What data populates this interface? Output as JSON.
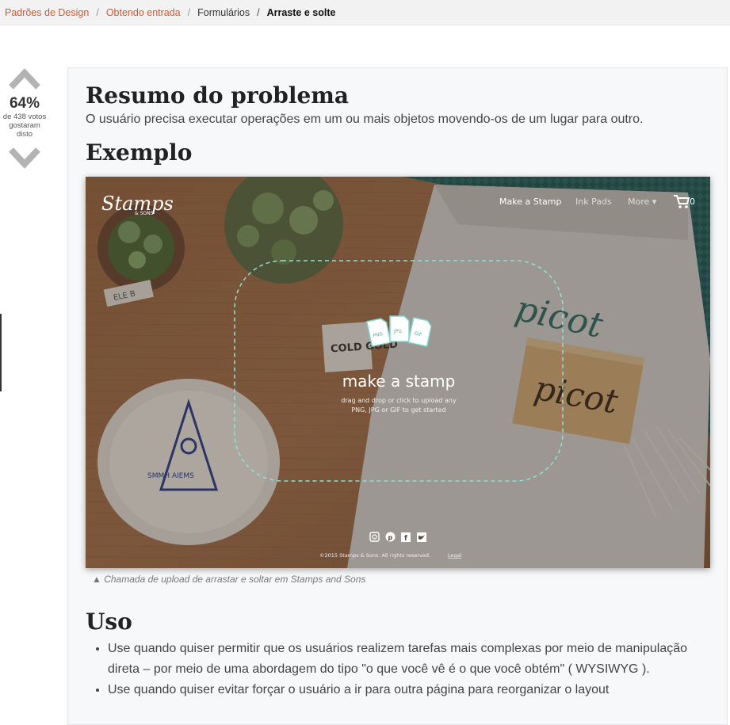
{
  "breadcrumb": {
    "items": [
      {
        "label": "Padrões de Design"
      },
      {
        "label": "Obtendo entrada"
      },
      {
        "label": "Formulários"
      },
      {
        "label": "Arraste e solte"
      }
    ],
    "separator": "/"
  },
  "vote": {
    "percent": "64%",
    "votes_line": "de 438 votos",
    "liked_line1": "gostaram",
    "liked_line2": "disto"
  },
  "content": {
    "summary_title": "Resumo do problema",
    "summary_text": "O usuário precisa executar operações em um ou mais objetos movendo-os de um lugar para outro.",
    "example_title": "Exemplo",
    "caption": "▲ Chamada de upload de arrastar e soltar em Stamps and Sons",
    "usage_title": "Uso",
    "usage_items": [
      "Use quando quiser permitir que os usuários realizem tarefas mais complexas por meio de manipulação direta – por meio de uma abordagem do tipo \"o que você vê é o que você obtém\" ( WYSIWYG ).",
      "Use quando quiser evitar forçar o usuário a ir para outra página para reorganizar o layout"
    ]
  },
  "example_screenshot": {
    "logo": "Stamps",
    "logo_sub": "& SONS",
    "nav": [
      "Make a Stamp",
      "Ink Pads",
      "More ▾"
    ],
    "cart_count": "0",
    "file_types": [
      "PNG",
      "JPG",
      "GIF"
    ],
    "heading": "make a stamp",
    "subtext_line1": "drag and drop or click to upload any",
    "subtext_line2": "PNG, JPG or GIF to get started",
    "footer": "©2015 Stamps & Sons. All rights reserved.",
    "footer_link": "Legal",
    "tag_text": "COLD GOLD",
    "card_word": "picot",
    "block_word": "picot",
    "small_tag": "ELE B",
    "bowl_text": "SMMH AIEMS",
    "colors": {
      "wood": "#b87a4e",
      "dashed_border": "#8fe0d8",
      "accent": "#d15a2b"
    }
  }
}
